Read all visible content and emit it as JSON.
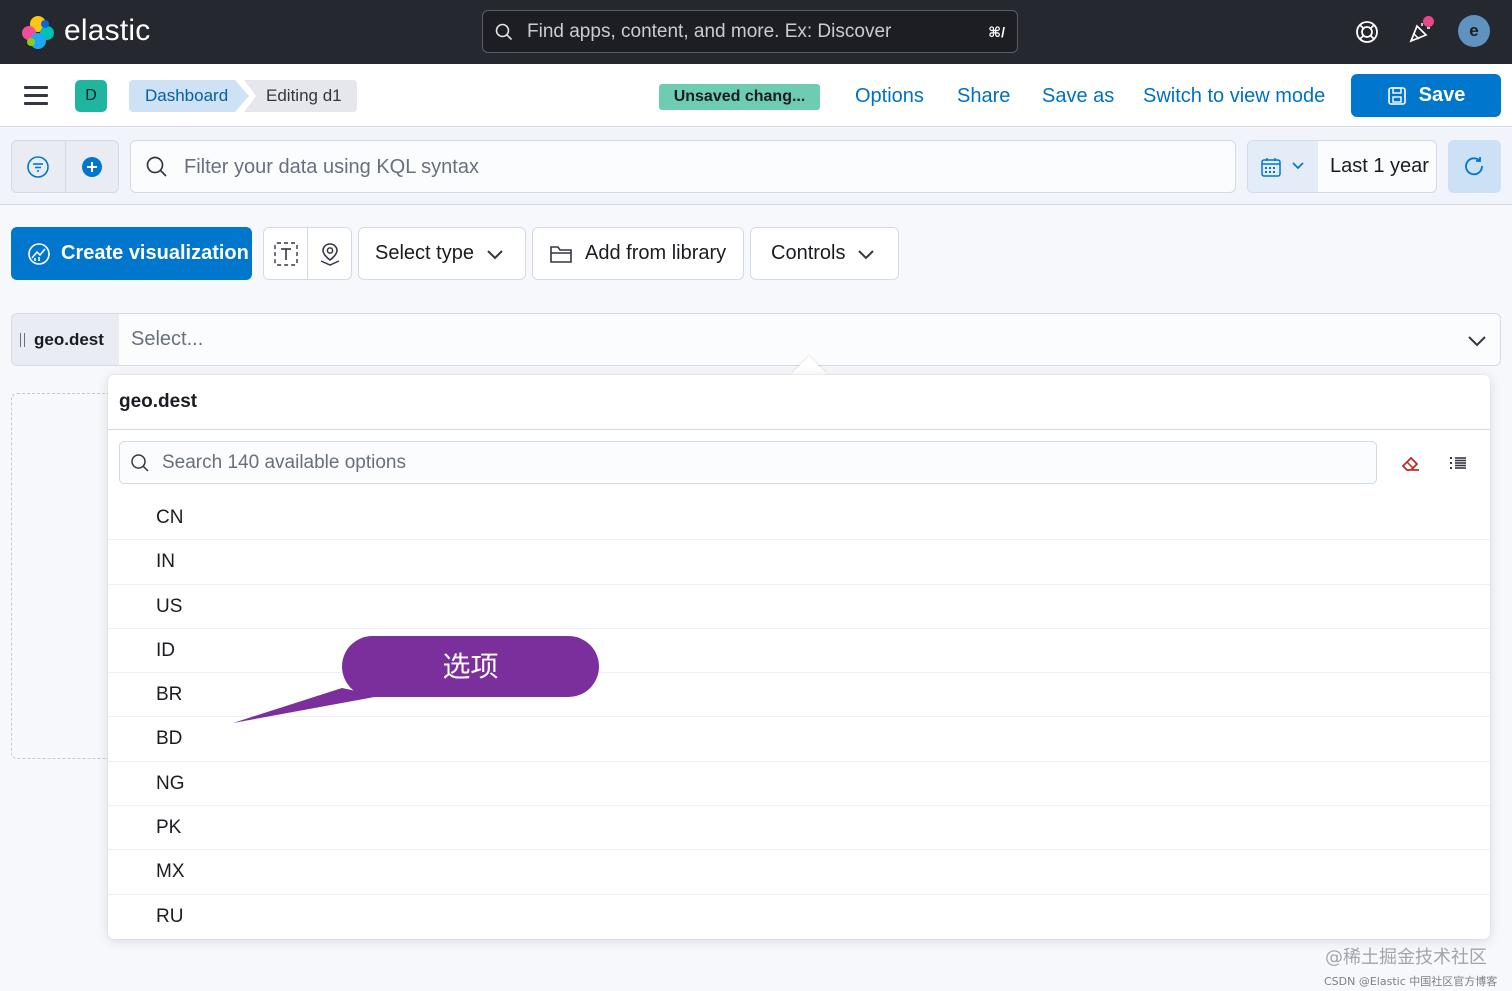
{
  "header": {
    "brand": "elastic",
    "search_placeholder": "Find apps, content, and more. Ex: Discover",
    "search_shortcut": "⌘/",
    "avatar_letter": "e"
  },
  "subheader": {
    "space_letter": "D",
    "breadcrumbs": [
      "Dashboard",
      "Editing d1"
    ],
    "unsaved_badge": "Unsaved chang...",
    "links": [
      "Options",
      "Share",
      "Save as",
      "Switch to view mode"
    ],
    "save_label": "Save"
  },
  "query": {
    "placeholder": "Filter your data using KQL syntax",
    "time_range": "Last 1 year"
  },
  "toolbar": {
    "create_label": "Create visualization",
    "select_type_label": "Select type",
    "add_library_label": "Add from library",
    "controls_label": "Controls"
  },
  "control": {
    "field": "geo.dest",
    "placeholder": "Select..."
  },
  "popover": {
    "title": "geo.dest",
    "search_placeholder": "Search 140 available options",
    "options": [
      "CN",
      "IN",
      "US",
      "ID",
      "BR",
      "BD",
      "NG",
      "PK",
      "MX",
      "RU"
    ]
  },
  "annotation": {
    "callout_text": "选项"
  },
  "watermark": {
    "line1": "@稀土掘金技术社区",
    "line2": "CSDN @Elastic 中国社区官方博客"
  },
  "colors": {
    "primary": "#0077cc",
    "header_bg": "#25282f",
    "unsaved_badge": "#6dccb1",
    "callout": "#7b2f9d",
    "space_avatar": "#20b5a0"
  }
}
